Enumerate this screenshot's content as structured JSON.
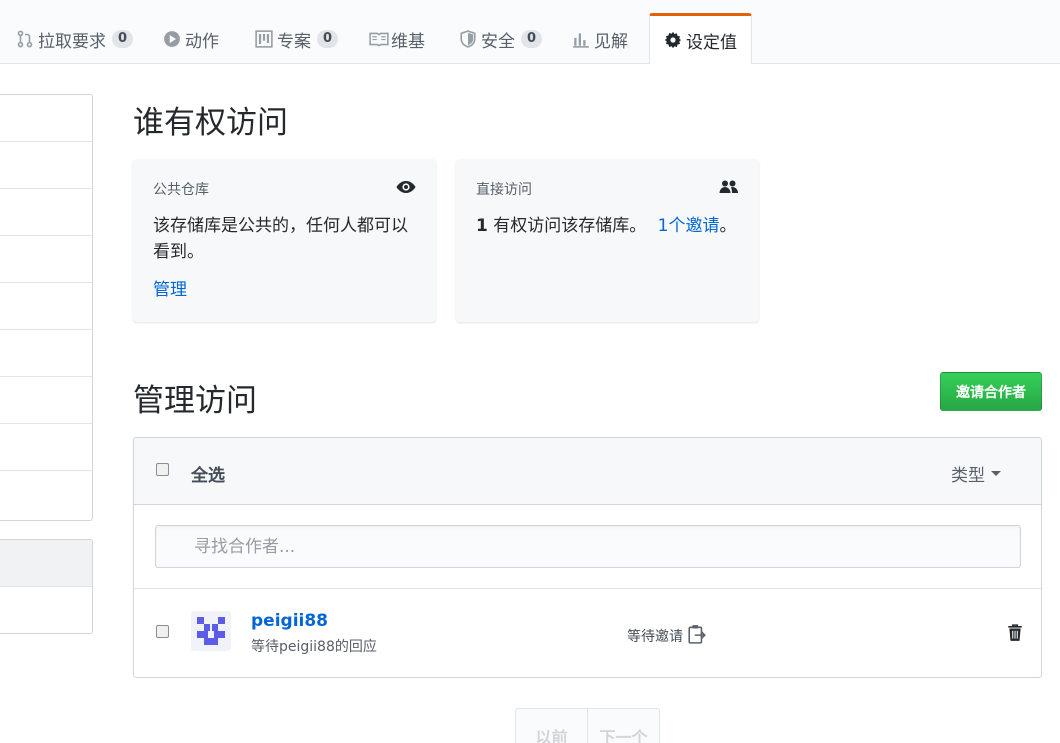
{
  "tabs": [
    {
      "label": "拉取要求",
      "count": "0",
      "icon": "git-pull-request-icon"
    },
    {
      "label": "动作",
      "icon": "play-icon"
    },
    {
      "label": "专案",
      "count": "0",
      "icon": "project-icon"
    },
    {
      "label": "维基",
      "icon": "book-icon"
    },
    {
      "label": "安全",
      "count": "0",
      "icon": "shield-icon"
    },
    {
      "label": "见解",
      "icon": "graph-icon"
    },
    {
      "label": "设定值",
      "icon": "gear-icon",
      "selected": true
    }
  ],
  "access": {
    "title": "谁有权访问",
    "public_card": {
      "label": "公共仓库",
      "body": "该存储库是公共的，任何人都可以看到。",
      "link": "管理",
      "icon": "eye-icon"
    },
    "direct_card": {
      "label": "直接访问",
      "count": "1",
      "body": "有权访问该存储库。",
      "invite_link": "1个邀请",
      "suffix": "。",
      "icon": "people-icon"
    }
  },
  "manage": {
    "title": "管理访问",
    "invite_button": "邀请合作者",
    "select_all": "全选",
    "type_filter": "类型",
    "search_placeholder": "寻找合作者...",
    "members": [
      {
        "username": "peigii88",
        "status": "等待peigii88的回应",
        "pending": "等待邀请"
      }
    ]
  },
  "pagination": {
    "prev": "以前",
    "next": "下一个"
  },
  "colors": {
    "accent": "#e36209",
    "link": "#0366d6",
    "primary_button": "#28a745"
  }
}
